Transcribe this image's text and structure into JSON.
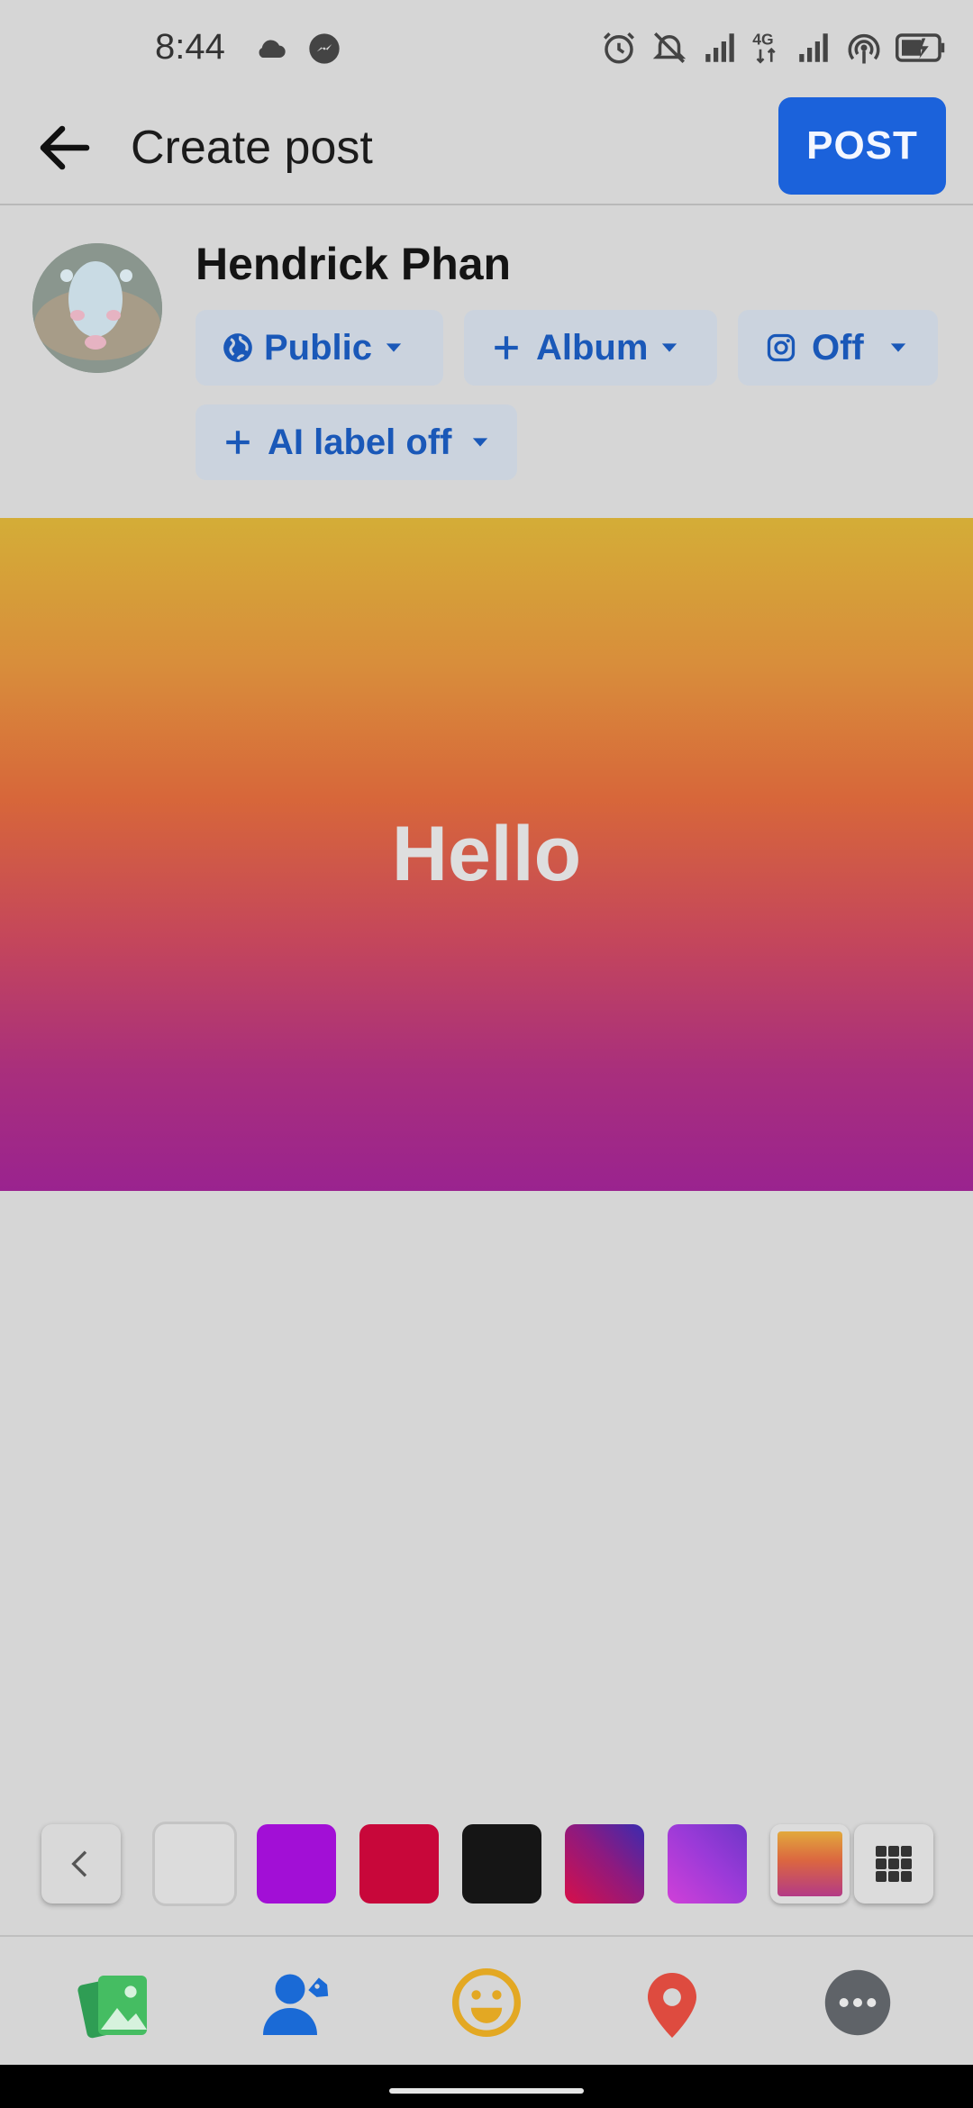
{
  "status_bar": {
    "time": "8:44",
    "left_icons": [
      "cloud-icon",
      "messenger-icon"
    ],
    "right_icons": [
      "alarm-icon",
      "bell-off-icon",
      "signal-icon",
      "4g-icon",
      "signal-icon",
      "hotspot-icon",
      "battery-charging-icon"
    ]
  },
  "header": {
    "title": "Create post",
    "post_label": "POST"
  },
  "user": {
    "name": "Hendrick Phan"
  },
  "chips": {
    "privacy": "Public",
    "album": "Album",
    "instagram": "Off",
    "ai_label": "AI label off"
  },
  "post": {
    "text": "Hello"
  },
  "background_picker": {
    "swatches": [
      "#dcdcdc",
      "#a20fd6",
      "#c8073a",
      "#151515",
      "gradient-purple-red",
      "gradient-purple-pink",
      "gradient-orange-purple"
    ]
  },
  "toolbar": {
    "items": [
      "photo-icon",
      "tag-people-icon",
      "feeling-icon",
      "location-icon",
      "more-icon"
    ]
  },
  "colors": {
    "accent": "#1b62db",
    "chip_text": "#1a58b8"
  }
}
